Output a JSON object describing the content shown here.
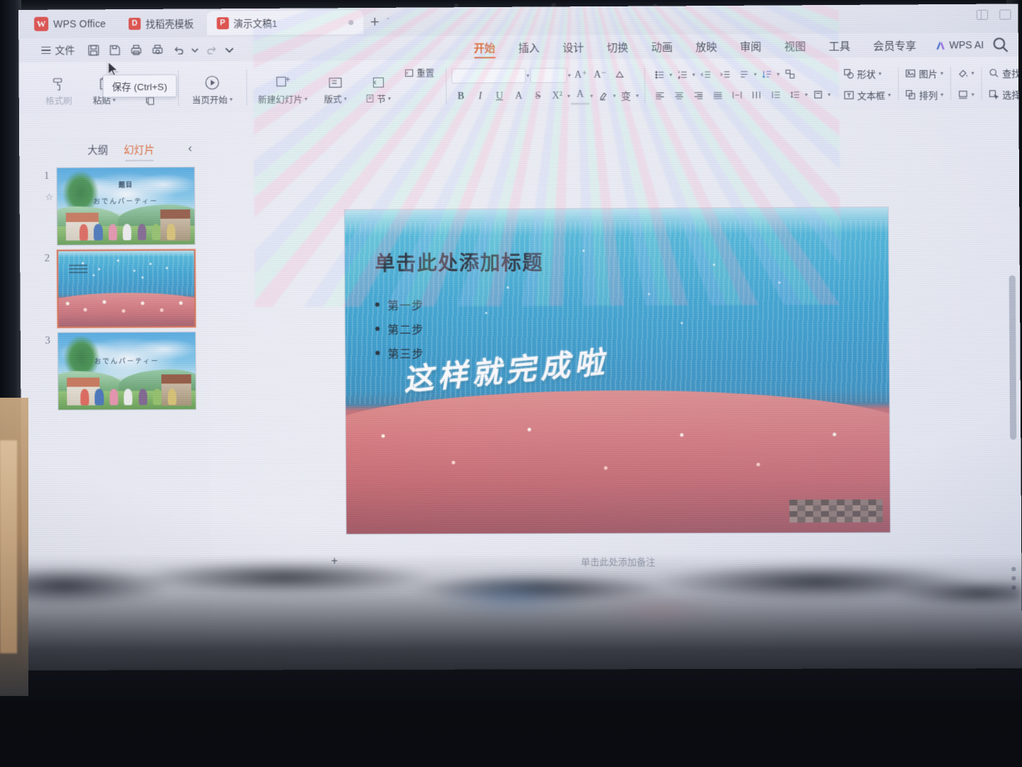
{
  "app": {
    "brand": "WPS Office",
    "brand_mark": "W"
  },
  "tabstrip": {
    "template_tab": {
      "label": "找稻壳模板",
      "icon": "docer-icon",
      "mark": "D"
    },
    "doc_tab": {
      "label": "演示文稿1",
      "icon": "presentation-icon",
      "mark": "P"
    },
    "new_tab": "+",
    "tab_menu_caret": "ˇ"
  },
  "quick_access": {
    "file_menu": "文件",
    "buttons": [
      {
        "name": "save-button",
        "icon": "save-icon"
      },
      {
        "name": "save-as-button",
        "icon": "save-as-icon"
      },
      {
        "name": "print-button",
        "icon": "print-icon"
      },
      {
        "name": "print-preview-button",
        "icon": "print-preview-icon"
      },
      {
        "name": "undo-button",
        "icon": "undo-icon"
      },
      {
        "name": "redo-button",
        "icon": "redo-icon"
      },
      {
        "name": "customize-button",
        "icon": "chevron-down-icon"
      }
    ]
  },
  "tooltip": {
    "text": "保存 (Ctrl+S)"
  },
  "ribbon_tabs": {
    "items": [
      "开始",
      "插入",
      "设计",
      "切换",
      "动画",
      "放映",
      "审阅",
      "视图",
      "工具",
      "会员专享"
    ],
    "active": "开始",
    "ai_label": "WPS AI",
    "search_icon": "search-icon"
  },
  "ribbon": {
    "clipboard": {
      "format_painter": "格式刷",
      "paste": "粘贴",
      "copy_icon": "copy-icon",
      "cut_icon": "scissors-icon"
    },
    "slideshow": {
      "label": "当页开始"
    },
    "slides": {
      "new_slide": "新建幻灯片",
      "layout": "版式",
      "section": "节",
      "reset": "重置"
    },
    "font": {
      "font_name_value": "",
      "font_size_value": "",
      "grow_font": "A⁺",
      "shrink_font": "A⁻",
      "clear_format_icon": "eraser-icon",
      "bold": "B",
      "italic": "I",
      "underline": "U",
      "shadow": "A",
      "strikethrough": "S",
      "superscript": "X²",
      "font_color": "A",
      "highlight_icon": "highlighter-icon",
      "char_style": "变"
    },
    "paragraph": {
      "bullets_icon": "bullet-list-icon",
      "numbering_icon": "numbered-list-icon",
      "decrease_indent_icon": "decrease-indent-icon",
      "increase_indent_icon": "increase-indent-icon",
      "pinyin_icon": "pinyin-guide-icon",
      "text_direction_icon": "text-direction-icon",
      "smartart_icon": "smartart-icon",
      "align_left_icon": "align-left-icon",
      "align_center_icon": "align-center-icon",
      "align_right_icon": "align-right-icon",
      "justify_icon": "justify-icon",
      "distribute_icon": "distribute-icon",
      "column_icon": "columns-icon",
      "line_spacing_icon": "line-spacing-icon",
      "align_text_icon": "align-text-icon"
    },
    "right_tools": [
      {
        "label": "形状",
        "icon": "shapes-icon"
      },
      {
        "label": "图片",
        "icon": "picture-icon"
      },
      {
        "label": "文本框",
        "icon": "textbox-icon"
      },
      {
        "label": "排列",
        "icon": "arrange-icon"
      },
      {
        "label": "查找",
        "icon": "find-icon"
      },
      {
        "label": "选择",
        "icon": "select-icon"
      }
    ],
    "fill_icon": "fill-color-icon",
    "outline_icon": "shape-outline-icon"
  },
  "panel": {
    "tabs": [
      {
        "label": "大纲",
        "active": false
      },
      {
        "label": "幻灯片",
        "active": true
      }
    ],
    "collapse_icon": "chevron-left-icon",
    "slides": [
      {
        "number": "1",
        "selected": false,
        "art": "village",
        "caption": "题目",
        "caption2": "おでんパーティー"
      },
      {
        "number": "2",
        "selected": true,
        "art": "sea",
        "caption": "",
        "caption2": ""
      },
      {
        "number": "3",
        "selected": false,
        "art": "village",
        "caption": "",
        "caption2": "おでんパーティー"
      }
    ]
  },
  "slide": {
    "title": "单击此处添加标题",
    "bullets": [
      "第一步",
      "第二步",
      "第三步"
    ],
    "handwriting": "这样就完成啦",
    "censored_region": "mosaic-block"
  },
  "notes": {
    "placeholder": "单击此处添加备注"
  },
  "colors": {
    "accent_orange": "#e2622a",
    "brand_red": "#e2453c",
    "ribbon_bg": "#eceef6",
    "slide_water": "#2f9fd0",
    "selected_thumb_border": "#d4694a"
  }
}
